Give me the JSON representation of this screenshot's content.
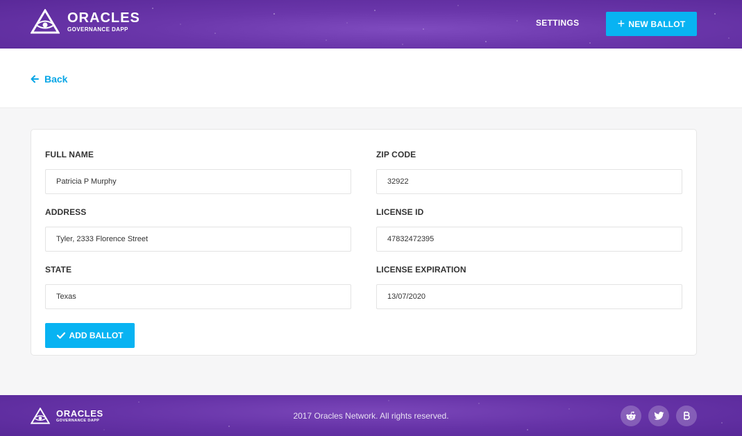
{
  "header": {
    "logo_title": "ORACLES",
    "logo_subtitle": "GOVERNANCE DAPP",
    "settings_label": "SETTINGS",
    "new_ballot_label": "NEW BALLOT"
  },
  "back_label": "Back",
  "form": {
    "full_name": {
      "label": "FULL NAME",
      "value": "Patricia P Murphy"
    },
    "address": {
      "label": "ADDRESS",
      "value": "Tyler, 2333 Florence Street"
    },
    "state": {
      "label": "STATE",
      "value": "Texas"
    },
    "zip_code": {
      "label": "ZIP CODE",
      "value": "32922"
    },
    "license_id": {
      "label": "LICENSE ID",
      "value": "47832472395"
    },
    "license_expiration": {
      "label": "LICENSE EXPIRATION",
      "value": "13/07/2020"
    },
    "submit_label": "ADD BALLOT"
  },
  "footer": {
    "logo_title": "ORACLES",
    "logo_subtitle": "GOVERNANCE DAPP",
    "copyright": "2017 Oracles Network. All rights reserved.",
    "social": [
      "reddit-icon",
      "twitter-icon",
      "bitcoin-icon"
    ]
  },
  "colors": {
    "brand_purple": "#6a36aa",
    "accent_blue": "#08b3f2",
    "link_blue": "#08a6e6"
  }
}
